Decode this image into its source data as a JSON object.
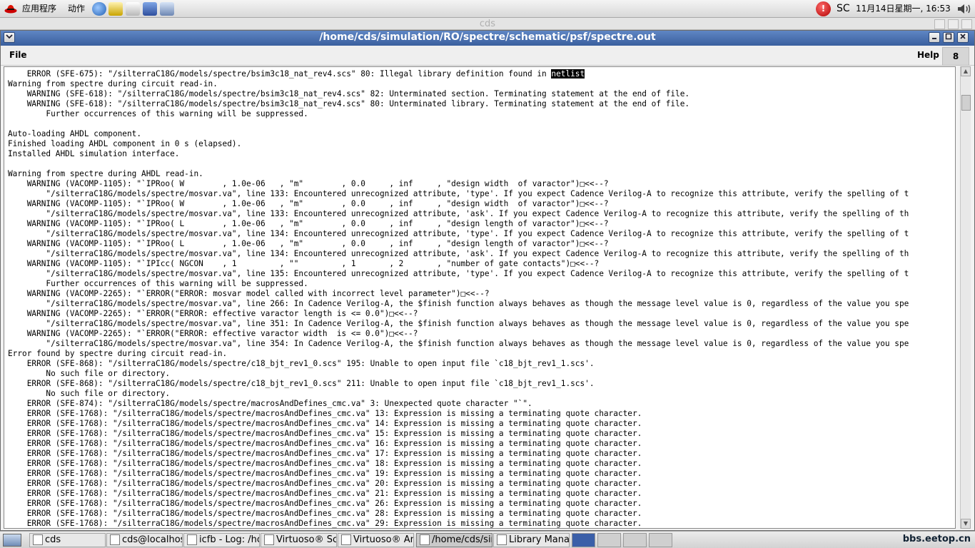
{
  "top_panel": {
    "menu_applications": "应用程序",
    "menu_actions": "动作",
    "launchers": [
      "browser-icon",
      "email-icon",
      "editor-icon",
      "office-icon",
      "print-icon"
    ],
    "tray_sc": "SC",
    "clock": "11月14日星期一, 16:53"
  },
  "background_window": {
    "title": "cds"
  },
  "window": {
    "title": "/home/cds/simulation/RO/spectre/schematic/psf/spectre.out",
    "menu_file": "File",
    "menu_help": "Help",
    "badge": "8",
    "log_highlight": "netlist",
    "log_lines": [
      "    ERROR (SFE-675): \"/silterraC18G/models/spectre/bsim3c18_nat_rev4.scs\" 80: Illegal library definition found in ",
      "Warning from spectre during circuit read-in.",
      "    WARNING (SFE-618): \"/silterraC18G/models/spectre/bsim3c18_nat_rev4.scs\" 82: Unterminated section. Terminating statement at the end of file.",
      "    WARNING (SFE-618): \"/silterraC18G/models/spectre/bsim3c18_nat_rev4.scs\" 80: Unterminated library. Terminating statement at the end of file.",
      "        Further occurrences of this warning will be suppressed.",
      "",
      "Auto-loading AHDL component.",
      "Finished loading AHDL component in 0 s (elapsed).",
      "Installed AHDL simulation interface.",
      "",
      "Warning from spectre during AHDL read-in.",
      "    WARNING (VACOMP-1105): \"`IPRoo( W        , 1.0e-06   , \"m\"        , 0.0     , inf     , \"design width  of varactor\")□<<--?",
      "        \"/silterraC18G/models/spectre/mosvar.va\", line 133: Encountered unrecognized attribute, 'type'. If you expect Cadence Verilog-A to recognize this attribute, verify the spelling of t",
      "    WARNING (VACOMP-1105): \"`IPRoo( W        , 1.0e-06   , \"m\"        , 0.0     , inf     , \"design width  of varactor\")□<<--?",
      "        \"/silterraC18G/models/spectre/mosvar.va\", line 133: Encountered unrecognized attribute, 'ask'. If you expect Cadence Verilog-A to recognize this attribute, verify the spelling of th",
      "    WARNING (VACOMP-1105): \"`IPRoo( L        , 1.0e-06   , \"m\"        , 0.0     , inf     , \"design length of varactor\")□<<--?",
      "        \"/silterraC18G/models/spectre/mosvar.va\", line 134: Encountered unrecognized attribute, 'type'. If you expect Cadence Verilog-A to recognize this attribute, verify the spelling of t",
      "    WARNING (VACOMP-1105): \"`IPRoo( L        , 1.0e-06   , \"m\"        , 0.0     , inf     , \"design length of varactor\")□<<--?",
      "        \"/silterraC18G/models/spectre/mosvar.va\", line 134: Encountered unrecognized attribute, 'ask'. If you expect Cadence Verilog-A to recognize this attribute, verify the spelling of th",
      "    WARNING (VACOMP-1105): \"`IPIcc( NGCON    , 1         , \"\"         , 1       , 2       , \"number of gate contacts\")□<<--?",
      "        \"/silterraC18G/models/spectre/mosvar.va\", line 135: Encountered unrecognized attribute, 'type'. If you expect Cadence Verilog-A to recognize this attribute, verify the spelling of t",
      "        Further occurrences of this warning will be suppressed.",
      "    WARNING (VACOMP-2265): \"`ERROR(\"ERROR: mosvar model called with incorrect level parameter\")□<<--?",
      "        \"/silterraC18G/models/spectre/mosvar.va\", line 266: In Cadence Verilog-A, the $finish function always behaves as though the message level value is 0, regardless of the value you spe",
      "    WARNING (VACOMP-2265): \"`ERROR(\"ERROR: effective varactor length is <= 0.0\")□<<--?",
      "        \"/silterraC18G/models/spectre/mosvar.va\", line 351: In Cadence Verilog-A, the $finish function always behaves as though the message level value is 0, regardless of the value you spe",
      "    WARNING (VACOMP-2265): \"`ERROR(\"ERROR: effective varactor width  is <= 0.0\")□<<--?",
      "        \"/silterraC18G/models/spectre/mosvar.va\", line 354: In Cadence Verilog-A, the $finish function always behaves as though the message level value is 0, regardless of the value you spe",
      "Error found by spectre during circuit read-in.",
      "    ERROR (SFE-868): \"/silterraC18G/models/spectre/c18_bjt_rev1_0.scs\" 195: Unable to open input file `c18_bjt_rev1_1.scs'.",
      "        No such file or directory.",
      "    ERROR (SFE-868): \"/silterraC18G/models/spectre/c18_bjt_rev1_0.scs\" 211: Unable to open input file `c18_bjt_rev1_1.scs'.",
      "        No such file or directory.",
      "    ERROR (SFE-874): \"/silterraC18G/models/spectre/macrosAndDefines_cmc.va\" 3: Unexpected quote character \"`\".",
      "    ERROR (SFE-1768): \"/silterraC18G/models/spectre/macrosAndDefines_cmc.va\" 13: Expression is missing a terminating quote character.",
      "    ERROR (SFE-1768): \"/silterraC18G/models/spectre/macrosAndDefines_cmc.va\" 14: Expression is missing a terminating quote character.",
      "    ERROR (SFE-1768): \"/silterraC18G/models/spectre/macrosAndDefines_cmc.va\" 15: Expression is missing a terminating quote character.",
      "    ERROR (SFE-1768): \"/silterraC18G/models/spectre/macrosAndDefines_cmc.va\" 16: Expression is missing a terminating quote character.",
      "    ERROR (SFE-1768): \"/silterraC18G/models/spectre/macrosAndDefines_cmc.va\" 17: Expression is missing a terminating quote character.",
      "    ERROR (SFE-1768): \"/silterraC18G/models/spectre/macrosAndDefines_cmc.va\" 18: Expression is missing a terminating quote character.",
      "    ERROR (SFE-1768): \"/silterraC18G/models/spectre/macrosAndDefines_cmc.va\" 19: Expression is missing a terminating quote character.",
      "    ERROR (SFE-1768): \"/silterraC18G/models/spectre/macrosAndDefines_cmc.va\" 20: Expression is missing a terminating quote character.",
      "    ERROR (SFE-1768): \"/silterraC18G/models/spectre/macrosAndDefines_cmc.va\" 21: Expression is missing a terminating quote character.",
      "    ERROR (SFE-1768): \"/silterraC18G/models/spectre/macrosAndDefines_cmc.va\" 26: Expression is missing a terminating quote character.",
      "    ERROR (SFE-1768): \"/silterraC18G/models/spectre/macrosAndDefines_cmc.va\" 28: Expression is missing a terminating quote character.",
      "    ERROR (SFE-1768): \"/silterraC18G/models/spectre/macrosAndDefines_cmc.va\" 29: Expression is missing a terminating quote character."
    ]
  },
  "taskbar": {
    "tasks": [
      {
        "label": "cds",
        "icon": "folder-icon"
      },
      {
        "label": "cds@localhos",
        "icon": "terminal-icon"
      },
      {
        "label": "icfb - Log: /ho",
        "icon": "window-icon"
      },
      {
        "label": "Virtuoso® Sch",
        "icon": "window-icon"
      },
      {
        "label": "Virtuoso® Ana",
        "icon": "window-icon"
      },
      {
        "label": "/home/cds/sin",
        "icon": "window-icon"
      },
      {
        "label": "Library Manag",
        "icon": "library-icon"
      }
    ],
    "watermark": "bbs.eetop.cn"
  }
}
